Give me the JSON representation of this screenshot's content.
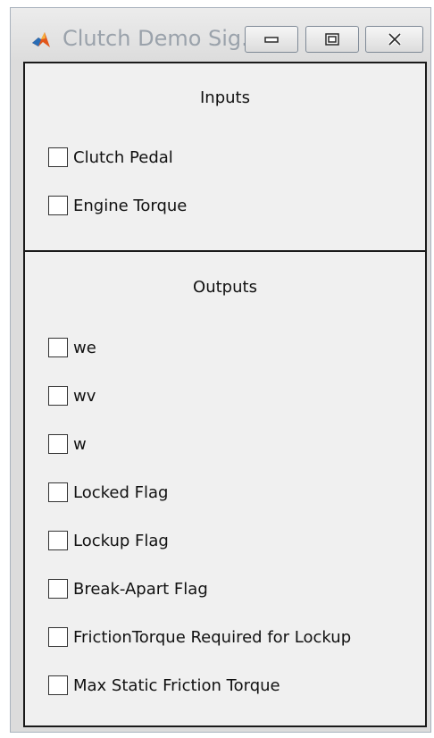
{
  "window": {
    "title": "Clutch Demo Sig..."
  },
  "inputs": {
    "title": "Inputs",
    "items": [
      {
        "label": "Clutch Pedal",
        "checked": false
      },
      {
        "label": "Engine Torque",
        "checked": false
      }
    ]
  },
  "outputs": {
    "title": "Outputs",
    "items": [
      {
        "label": "we",
        "checked": false
      },
      {
        "label": "wv",
        "checked": false
      },
      {
        "label": "w",
        "checked": false
      },
      {
        "label": "Locked Flag",
        "checked": false
      },
      {
        "label": "Lockup Flag",
        "checked": false
      },
      {
        "label": "Break-Apart Flag",
        "checked": false
      },
      {
        "label": "FrictionTorque Required for Lockup",
        "checked": false
      },
      {
        "label": "Max Static Friction Torque",
        "checked": false
      }
    ]
  },
  "icons": {
    "app": "matlab-icon",
    "minimize": "minimize-icon",
    "maximize": "maximize-icon",
    "close": "close-icon"
  },
  "colors": {
    "window_frame": "#dcdcdc",
    "panel_bg": "#f0f0f0",
    "panel_border": "#1a1a1a",
    "title_text": "#9aa2ab"
  }
}
